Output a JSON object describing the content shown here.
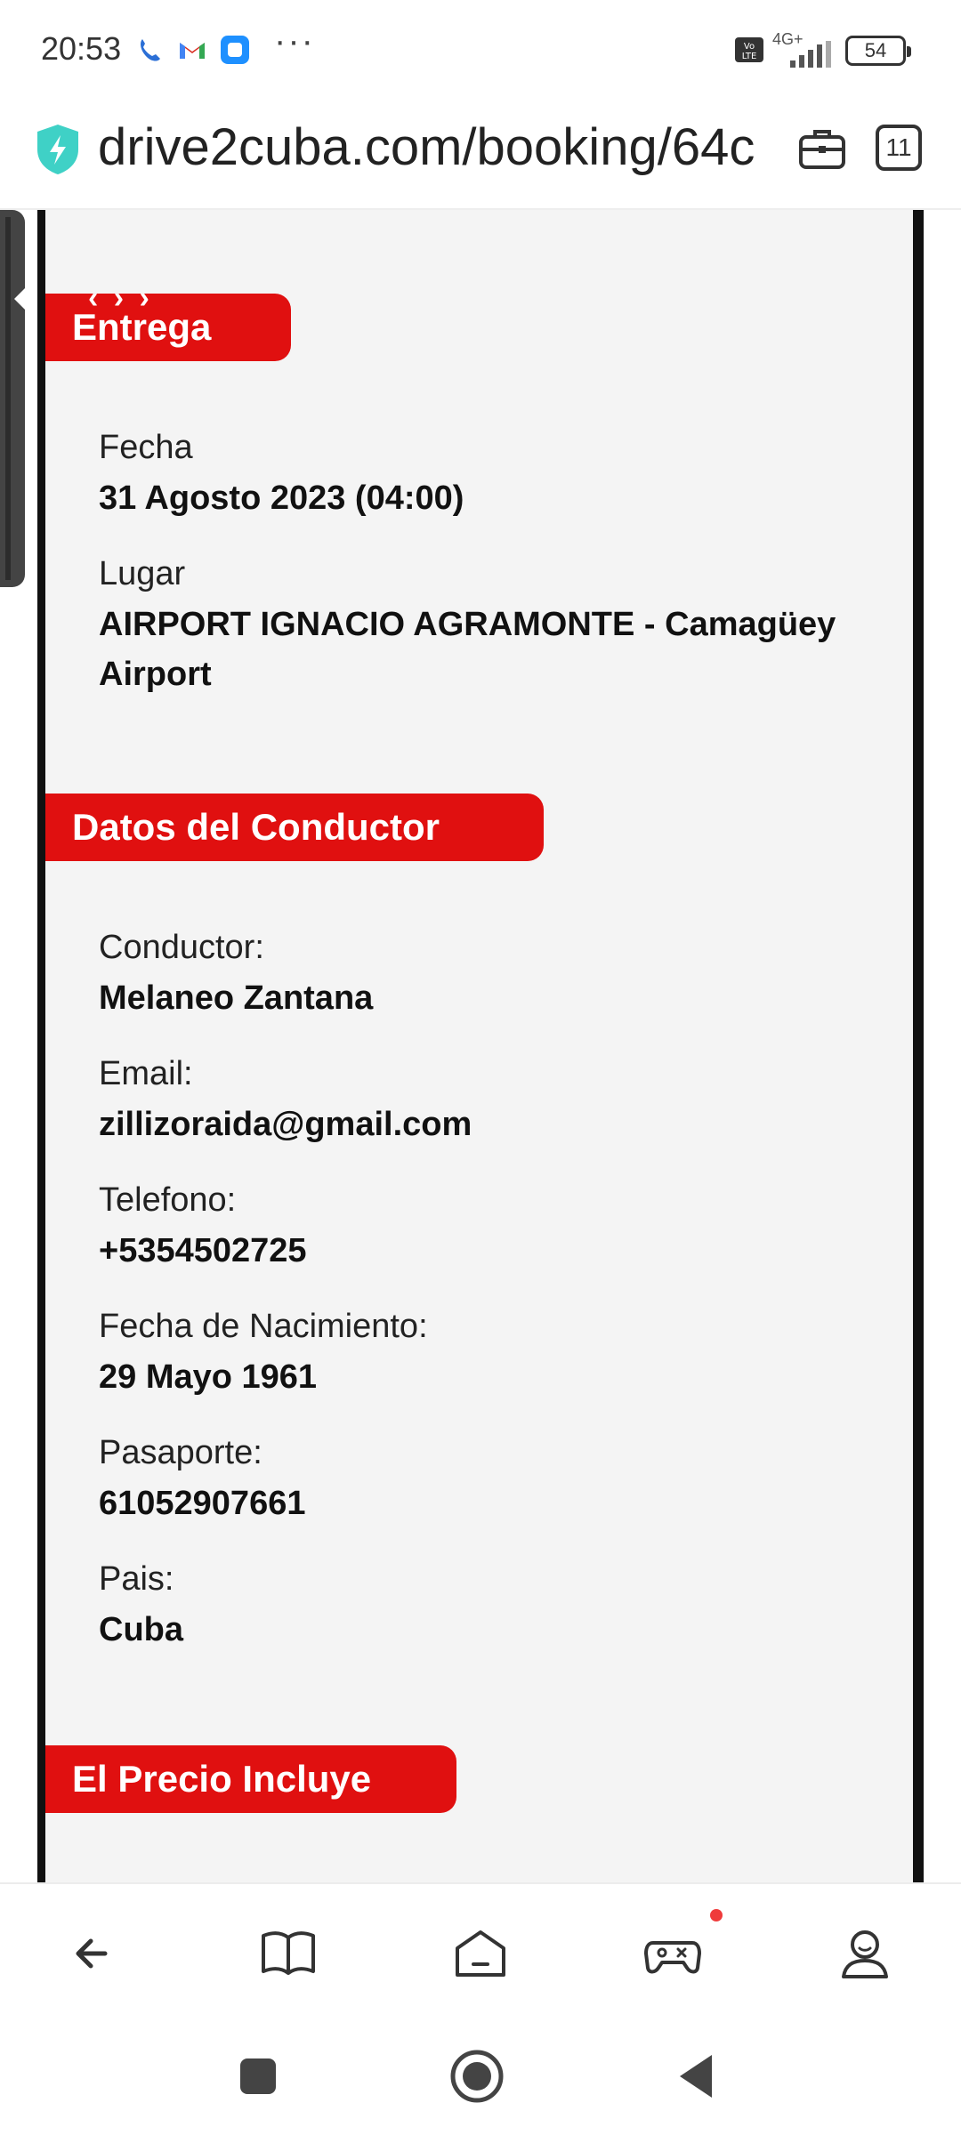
{
  "status_bar": {
    "time": "20:53",
    "network": "4G+",
    "battery": "54"
  },
  "browser": {
    "url": "drive2cuba.com/booking/64c",
    "tab_count": "11"
  },
  "entrega": {
    "title": "Entrega",
    "fecha_label": "Fecha",
    "fecha_value": "31 Agosto 2023 (04:00)",
    "lugar_label": "Lugar",
    "lugar_value": "AIRPORT IGNACIO AGRAMONTE - Camagüey Airport"
  },
  "conductor": {
    "title": "Datos del Conductor",
    "fields": [
      {
        "label": "Conductor:",
        "value": "Melaneo Zantana"
      },
      {
        "label": "Email:",
        "value": "zillizoraida@gmail.com"
      },
      {
        "label": "Telefono:",
        "value": "+5354502725"
      },
      {
        "label": "Fecha de Nacimiento:",
        "value": "29 Mayo 1961"
      },
      {
        "label": "Pasaporte:",
        "value": "61052907661"
      },
      {
        "label": "Pais:",
        "value": "Cuba"
      }
    ]
  },
  "precio": {
    "title": "El Precio Incluye"
  },
  "colors": {
    "accent_red": "#e01010",
    "card_bg": "#f4f4f4",
    "border": "#111111"
  },
  "icons": {
    "bottom_nav": [
      "back-arrow-icon",
      "book-icon",
      "home-icon",
      "gamepad-icon",
      "profile-icon"
    ],
    "system_nav": [
      "recents-icon",
      "home-circle-icon",
      "back-triangle-icon"
    ]
  }
}
